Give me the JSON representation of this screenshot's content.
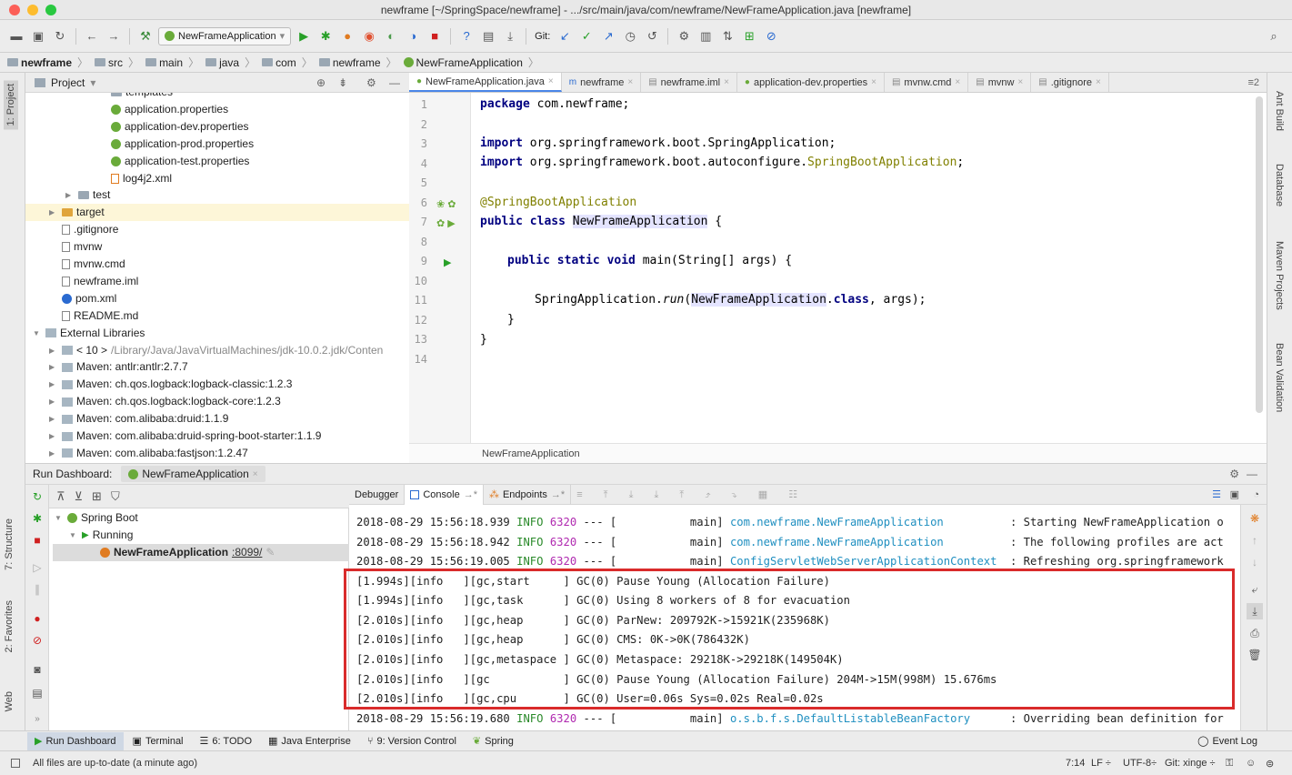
{
  "window": {
    "title": "newframe [~/SpringSpace/newframe] - .../src/main/java/com/newframe/NewFrameApplication.java [newframe]"
  },
  "toolbar": {
    "run_config": "NewFrameApplication",
    "git_label": "Git:"
  },
  "breadcrumb": [
    "newframe",
    "src",
    "main",
    "java",
    "com",
    "newframe",
    "NewFrameApplication"
  ],
  "left_tool_tabs": [
    "1: Project",
    "7: Structure",
    "2: Favorites",
    "Web"
  ],
  "right_tool_tabs": [
    "Ant Build",
    "Database",
    "Maven Projects",
    "Bean Validation"
  ],
  "project": {
    "header": "Project",
    "items": [
      {
        "label": "templates",
        "indent": 4,
        "icon": "folder"
      },
      {
        "label": "application.properties",
        "indent": 4,
        "icon": "leaf"
      },
      {
        "label": "application-dev.properties",
        "indent": 4,
        "icon": "leaf"
      },
      {
        "label": "application-prod.properties",
        "indent": 4,
        "icon": "leaf"
      },
      {
        "label": "application-test.properties",
        "indent": 4,
        "icon": "leaf"
      },
      {
        "label": "log4j2.xml",
        "indent": 4,
        "icon": "xml"
      },
      {
        "label": "test",
        "indent": 2,
        "icon": "folder",
        "arrow": "▶"
      },
      {
        "label": "target",
        "indent": 1,
        "icon": "ofolder",
        "arrow": "▶",
        "selected": true
      },
      {
        "label": ".gitignore",
        "indent": 1,
        "icon": "file"
      },
      {
        "label": "mvnw",
        "indent": 1,
        "icon": "file"
      },
      {
        "label": "mvnw.cmd",
        "indent": 1,
        "icon": "file"
      },
      {
        "label": "newframe.iml",
        "indent": 1,
        "icon": "file"
      },
      {
        "label": "pom.xml",
        "indent": 1,
        "icon": "maven"
      },
      {
        "label": "README.md",
        "indent": 1,
        "icon": "file"
      },
      {
        "label": "External Libraries",
        "indent": 0,
        "icon": "lib",
        "arrow": "▼"
      },
      {
        "label": "< 10 >",
        "suffix": "/Library/Java/JavaVirtualMachines/jdk-10.0.2.jdk/Conten",
        "indent": 1,
        "icon": "lib",
        "arrow": "▶"
      },
      {
        "label": "Maven: antlr:antlr:2.7.7",
        "indent": 1,
        "icon": "lib",
        "arrow": "▶"
      },
      {
        "label": "Maven: ch.qos.logback:logback-classic:1.2.3",
        "indent": 1,
        "icon": "lib",
        "arrow": "▶"
      },
      {
        "label": "Maven: ch.qos.logback:logback-core:1.2.3",
        "indent": 1,
        "icon": "lib",
        "arrow": "▶"
      },
      {
        "label": "Maven: com.alibaba:druid:1.1.9",
        "indent": 1,
        "icon": "lib",
        "arrow": "▶"
      },
      {
        "label": "Maven: com.alibaba:druid-spring-boot-starter:1.1.9",
        "indent": 1,
        "icon": "lib",
        "arrow": "▶"
      },
      {
        "label": "Maven: com.alibaba:fastjson:1.2.47",
        "indent": 1,
        "icon": "lib",
        "arrow": "▶"
      }
    ]
  },
  "editor_tabs": [
    "NewFrameApplication.java",
    "newframe",
    "newframe.iml",
    "application-dev.properties",
    "mvnw.cmd",
    "mvnw",
    ".gitignore"
  ],
  "editor_tab_overflow": "≡2",
  "code": {
    "line_numbers": [
      "1",
      "2",
      "3",
      "4",
      "5",
      "6",
      "7",
      "8",
      "9",
      "10",
      "11",
      "12",
      "13",
      "14"
    ],
    "l1_kw": "package",
    "l1_rest": " com.newframe;",
    "l3_kw": "import",
    "l3_rest": " org.springframework.boot.SpringApplication;",
    "l4_kw": "import",
    "l4_rest": " org.springframework.boot.autoconfigure.",
    "l4_ann": "SpringBootApplication",
    "l4_end": ";",
    "l6_ann": "@SpringBootApplication",
    "l7_kw": "public class",
    "l7_name": "NewFrameApplication",
    "l7_end": " {",
    "l9_kw": "public static void",
    "l9_rest": " main(String[] args) {",
    "l11_a": "SpringApplication.",
    "l11_run": "run",
    "l11_b": "(",
    "l11_cls": "NewFrameApplication",
    "l11_c": ".",
    "l11_kw": "class",
    "l11_d": ", args);",
    "l12": "}",
    "l13": "}",
    "breadcrumb": "NewFrameApplication"
  },
  "run_dashboard": {
    "label": "Run Dashboard:",
    "tab": "NewFrameApplication",
    "tree": {
      "root": "Spring Boot",
      "group": "Running",
      "app": "NewFrameApplication",
      "port": ":8099/"
    }
  },
  "console": {
    "tabs": [
      "Debugger",
      "Console",
      "Endpoints"
    ],
    "logs": [
      {
        "ts": "2018-08-29 15:56:18.939",
        "level": "INFO",
        "pid": "6320",
        "sep": "--- [",
        "thread": "main]",
        "cls": "com.newframe.NewFrameApplication",
        "msg": ": Starting NewFrameApplication o"
      },
      {
        "ts": "2018-08-29 15:56:18.942",
        "level": "INFO",
        "pid": "6320",
        "sep": "--- [",
        "thread": "main]",
        "cls": "com.newframe.NewFrameApplication",
        "msg": ": The following profiles are act"
      },
      {
        "ts": "2018-08-29 15:56:19.005",
        "level": "INFO",
        "pid": "6320",
        "sep": "--- [",
        "thread": "main]",
        "cls": "ConfigServletWebServerApplicationContext",
        "msg": ": Refreshing org.springframework"
      }
    ],
    "gc": [
      "[1.994s][info   ][gc,start     ] GC(0) Pause Young (Allocation Failure)",
      "[1.994s][info   ][gc,task      ] GC(0) Using 8 workers of 8 for evacuation",
      "[2.010s][info   ][gc,heap      ] GC(0) ParNew: 209792K->15921K(235968K)",
      "[2.010s][info   ][gc,heap      ] GC(0) CMS: 0K->0K(786432K)",
      "[2.010s][info   ][gc,metaspace ] GC(0) Metaspace: 29218K->29218K(149504K)",
      "[2.010s][info   ][gc           ] GC(0) Pause Young (Allocation Failure) 204M->15M(998M) 15.676ms",
      "[2.010s][info   ][gc,cpu       ] GC(0) User=0.06s Sys=0.02s Real=0.02s"
    ],
    "last": {
      "ts": "2018-08-29 15:56:19.680",
      "level": "INFO",
      "pid": "6320",
      "sep": "--- [",
      "thread": "main]",
      "cls": "o.s.b.f.s.DefaultListableBeanFactory",
      "msg": ": Overriding bean definition for"
    }
  },
  "bottom_tabs": [
    "Run Dashboard",
    "Terminal",
    "6: TODO",
    "Java Enterprise",
    "9: Version Control",
    "Spring"
  ],
  "event_log": "Event Log",
  "status": {
    "message": "All files are up-to-date (a minute ago)",
    "position": "7:14",
    "line_sep": "LF ÷",
    "encoding": "UTF-8÷",
    "git": "Git: xinge ÷"
  }
}
